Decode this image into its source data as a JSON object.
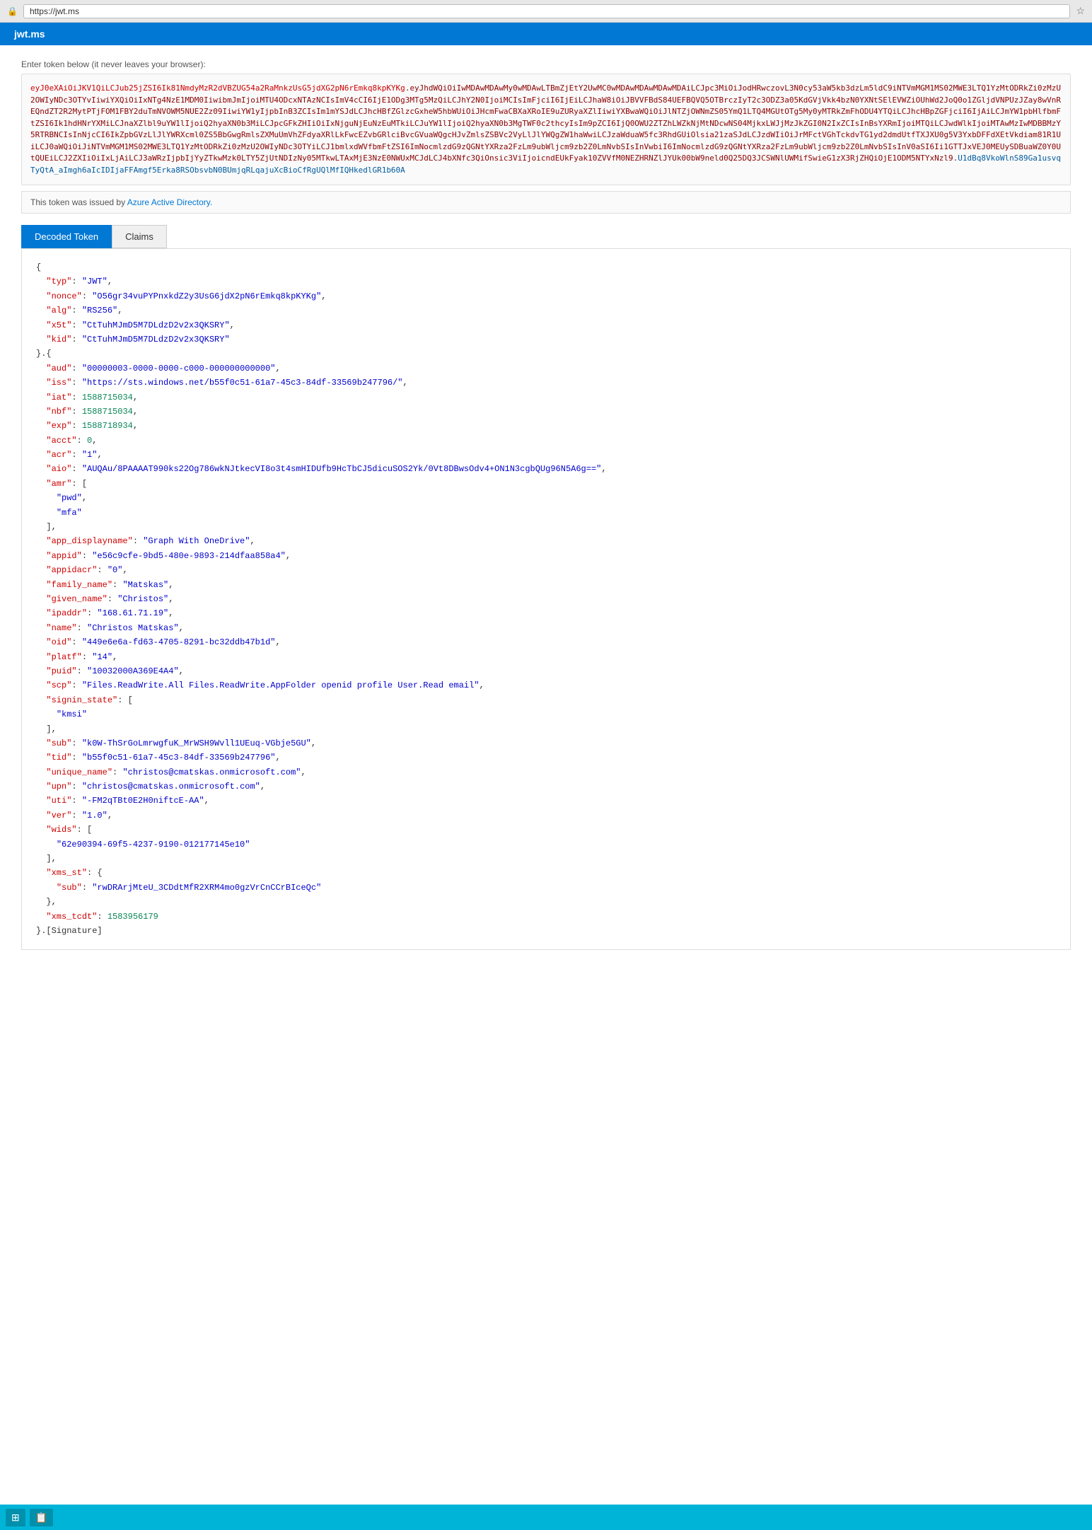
{
  "browser": {
    "url": "https://jwt.ms",
    "lock_icon": "🔒",
    "star_icon": "☆"
  },
  "header": {
    "title": "jwt.ms"
  },
  "token_section": {
    "label": "Enter token below (it never leaves your browser):",
    "token_red": "eyJ0eXAiOiJKV1QiLCJub25jZSI6Ik81NmdyMzR2dVBZUG54a2RaMnkzUsG5jdXG2pN6rEmkq8kpKYKg",
    "token_full": "eyJ0eXAiOiJKV1QiLCJub25jZSI6Ik81NmdyMzR2dVBZUG54a2RaMnkzUsG5jdXG2pN6rEmkq8kpKYKg.eyJhdWQiOiIwMDAwMDAwMy0wMDAwLTBmZjEtY2UwMC0wMDAwMDAwMDAwMDAiLCJpc3MiOiJodHRwczovL3N0cy53aW5kb3dzLm5ldC9iNTVmMGM1MS02MWE3LTQ1YzMtODRkZi0zMzU2OWIyNDc3OTYvIiwiYXQiOiIxNTg4NzE1MDM0IiwibmJmIjoiMTU4ODcxNTAzNCIsImV4cCI6IjE1ODg3MTg5MzQiLCJhY2N0IjoiMCIsImFjciI6IjEiLCJhaW8iOiJBVVFBdS84UEFBQVQ5OTBrczIyT2c3ODZ3a05KdGVjVkk4bzN0YXNtSElEVWZiOUhWd2JoQ0o1ZGljdVNPUzJZay8wVnREQndZT2R2MytPTjFOM1FBY2duTmNVOWM5NUE2Zz09IiwiYW1yIjpbInB3ZCIsIm1mYSJdLCJhcHBfZGlzcGxheW5hbWUiOiJHcmFwaCBXaXRoIE9uZURyaXZlIiwiYXBwaWQiOiJlNTZjOWNmZS05YmQ1LTQ4MGUtOTg5My0yMTRkZmFhODU4YTQiLCJhcHBpZGFjciI6IjAiLCJmYW1pbHlfbmFtZSI6Ik1hdHNrYXMiLCJnaXZlbl9uYW1lIjoiQ2hyaXN0b3MiLCJpcGFkZHIiOiIxNjguNjEuNzEuMTkiLCJuYW1lIjoiQ2hyaXN0b3MgTWF0c2thcyIsIm9pZCI6IjQ0OWU2ZTZhLWZkNjMtNDcwNS04MjkxLWJjMzJkZGI0N2IxZCIsInBsYXRmIjoiMTQiLCJwdWlkIjoiMTAwMzIwMDBBMzY5RTRBNCIsInNjcCI6IkZpbGVzLlJlYWRXcml0ZS5BbGwgRmlsZXMuUmVhZFdyaXRlLkFwcEZvbGRlciBvcGVuaWQgcHJvZmlsZSBVc2VyLlJlYWQgZW1haWwiLCJzaWduaW5fc3RhdGUiOlsia21zaSJdLCJzdWIiOiJrMFctVGhTckdvTG1yd2dmdUtfTXJXU0g5V3YxbDFFdXEtVkdiam81R1UiLCJ0aWQiOiJiNTVmMGM1MS02MWE3LTQ1YzMtODRkZi0zMzU2OWIyNDc3OTYiLCJ1bmlxdWVfbmFtZSI6ImNocmlzdG9zQGNtYXRza2FzLm9ubWljcm9zb2Z0LmNvbSIsInVwbiI6ImNocmlzdG9zQGNtYXRza2FzLm9ubWljcm9zb2Z0LmNvbSIsInV0aSI6Ii1GTTJxVEJ0MEUySDBuaWZ0Y0UtQUEiLCJ2ZXIiOiIxLjAiLCJ3aWRzIjpbIjYyZTkwMzk0LTY5ZjUtNDIzNy05MTkwLTAxMjE3NzE0NWUxMCJdLCJ4bXNfc3QiOnsic3ViIjoicndEUkFyak10ZVVfM0NEZHRNZlJYUk00bW9neld0Q25DQ3JCSWNlUWMifSwieG1zX3RjZHQiOjE1ODM5NTYxNzl9.U1dBq8VkoWlnS89Ga1usvqTyQtA_aImgh6aIcIDIjaFFAmgf5Erka8RSObsvbN0BUmjqRLqajuXcBioCfRgUQlMfIQHkedlGR1b60A",
    "issuer_note": "This token was issued by",
    "issuer_link_text": "Azure Active Directory.",
    "issuer_link_url": "#"
  },
  "tabs": [
    {
      "label": "Decoded Token",
      "active": true
    },
    {
      "label": "Claims",
      "active": false
    }
  ],
  "decoded": {
    "header": {
      "typ": "JWT",
      "nonce": "O56gr34vuPYPnxkdZ2y3UsG6jdX2pN6rEmkq8kpKYKg",
      "alg": "RS256",
      "x5t": "CtTuhMJmD5M7DLdzD2v2x3QKSRY",
      "kid": "CtTuhMJmD5M7DLdzD2v2x3QKSRY"
    },
    "payload": {
      "aud": "00000003-0000-0000-c000-000000000000",
      "iss": "https://sts.windows.net/b55f0c51-61a7-45c3-84df-33569b247796/",
      "iat": 1588715034,
      "nbf": 1588715034,
      "exp": 1588718934,
      "acct": 0,
      "acr": "1",
      "aio": "AUQAu/8PAAAAT990ks22Og786wkNJtkecVI8o3t4smHIDUfb9HcTbCJ5dicuSOS2Yk/0Vt8DBwsOdv4+ON1N3cgbQUg96N5A6g==",
      "amr": [
        "pwd",
        "mfa"
      ],
      "app_displayname": "Graph With OneDrive",
      "appid": "e56c9cfe-9bd5-480e-9893-214dfaa858a4",
      "appidacr": "0",
      "family_name": "Matskas",
      "given_name": "Christos",
      "ipaddr": "168.61.71.19",
      "name": "Christos Matskas",
      "oid": "449e6e6a-fd63-4705-8291-bc32ddb47b1d",
      "platf": "14",
      "puid": "10032000A369E4A4",
      "scp": "Files.ReadWrite.All Files.ReadWrite.AppFolder openid profile User.Read email",
      "signin_state": [
        "kmsi"
      ],
      "sub": "k0W-ThSrGoLmrwgfuK_MrWSH9Wvll1UEuq-VGbje5GU",
      "tid": "b55f0c51-61a7-45c3-84df-33569b247796",
      "unique_name": "christos@cmatskas.onmicrosoft.com",
      "upn": "christos@cmatskas.onmicrosoft.com",
      "uti": "-FM2qTBt0E2H0niftcE-AA",
      "ver": "1.0",
      "wids": [
        "62e90394-69f5-4237-9190-012177145e10"
      ],
      "xms_st": {
        "sub": "rwDRArjMteU_3CDdtMfR2XRM4mo0gzVrCnCCrBIceQc"
      },
      "xms_tcdt": 1583956179
    }
  },
  "taskbar": {
    "btn1": "⊞",
    "btn2": "📋"
  }
}
